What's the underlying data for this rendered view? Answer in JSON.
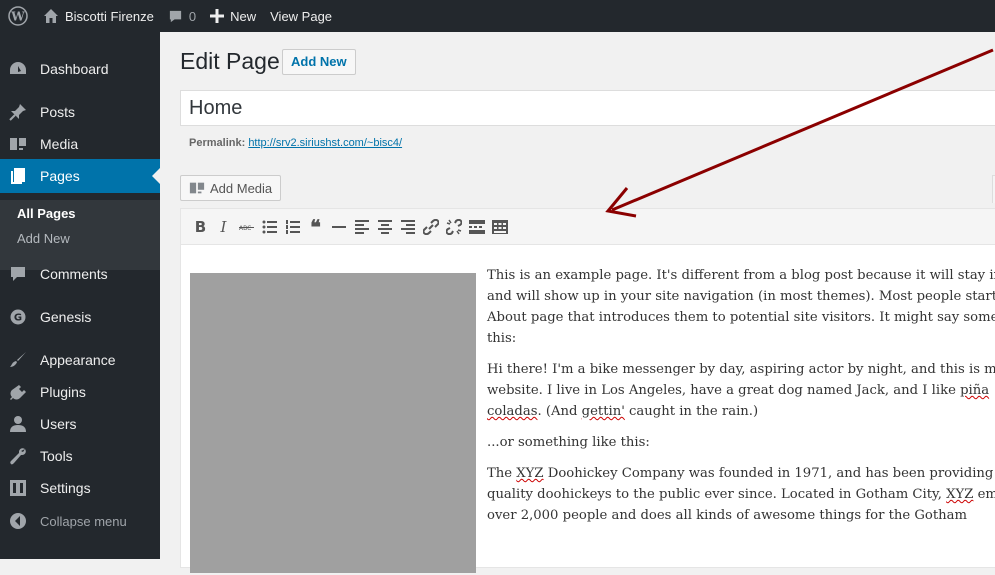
{
  "adminbar": {
    "site_name": "Biscotti Firenze",
    "comments_count": "0",
    "new_label": "New",
    "view_page_label": "View Page"
  },
  "sidebar": {
    "items": [
      {
        "label": "Dashboard",
        "icon": "dashboard-icon"
      },
      {
        "label": "Posts",
        "icon": "pushpin-icon"
      },
      {
        "label": "Media",
        "icon": "media-icon"
      },
      {
        "label": "Pages",
        "icon": "pages-icon"
      },
      {
        "label": "Comments",
        "icon": "comment-icon"
      },
      {
        "label": "Genesis",
        "icon": "genesis-icon"
      },
      {
        "label": "Appearance",
        "icon": "brush-icon"
      },
      {
        "label": "Plugins",
        "icon": "plugin-icon"
      },
      {
        "label": "Users",
        "icon": "users-icon"
      },
      {
        "label": "Tools",
        "icon": "wrench-icon"
      },
      {
        "label": "Settings",
        "icon": "settings-icon"
      }
    ],
    "submenu": [
      "All Pages",
      "Add New"
    ],
    "collapse_label": "Collapse menu"
  },
  "main": {
    "page_title": "Edit Page",
    "add_new_label": "Add New",
    "title_value": "Home",
    "permalink_label": "Permalink:",
    "permalink_url": "http://srv2.siriushst.com/~bisc4/",
    "add_media_label": "Add Media"
  },
  "toolbar_icons": [
    "bold",
    "italic",
    "strikethrough",
    "bullet-list",
    "numbered-list",
    "blockquote",
    "horizontal-rule",
    "align-left",
    "align-center",
    "align-right",
    "link",
    "unlink",
    "read-more",
    "toolbar-toggle"
  ],
  "content": {
    "p1": [
      "This is an example page. It's different from a blog post because it will stay in",
      "and will show up in your site navigation (in most themes). Most people start",
      "About page that introduces them to potential site visitors. It might say some",
      "this:"
    ],
    "p2": [
      "Hi there! I'm a bike messenger by day, aspiring actor by night, and this is my",
      "website. I live in Los Angeles, have a great dog named Jack, and I like ",
      "piña",
      " ",
      "coladas",
      ". (And ",
      "gettin'",
      " caught in the rain.)"
    ],
    "p3": "...or something like this:",
    "p4": [
      "The ",
      "XYZ",
      " Doohickey Company was founded in 1971, and has been providing",
      "quality doohickeys to the public ever since. Located in Gotham City, ",
      "XYZ",
      " em",
      "over 2,000 people and does all kinds of awesome things for the Gotham"
    ]
  },
  "colors": {
    "admin_bg": "#23282d",
    "accent": "#0073aa",
    "arrow": "#8b0000"
  }
}
